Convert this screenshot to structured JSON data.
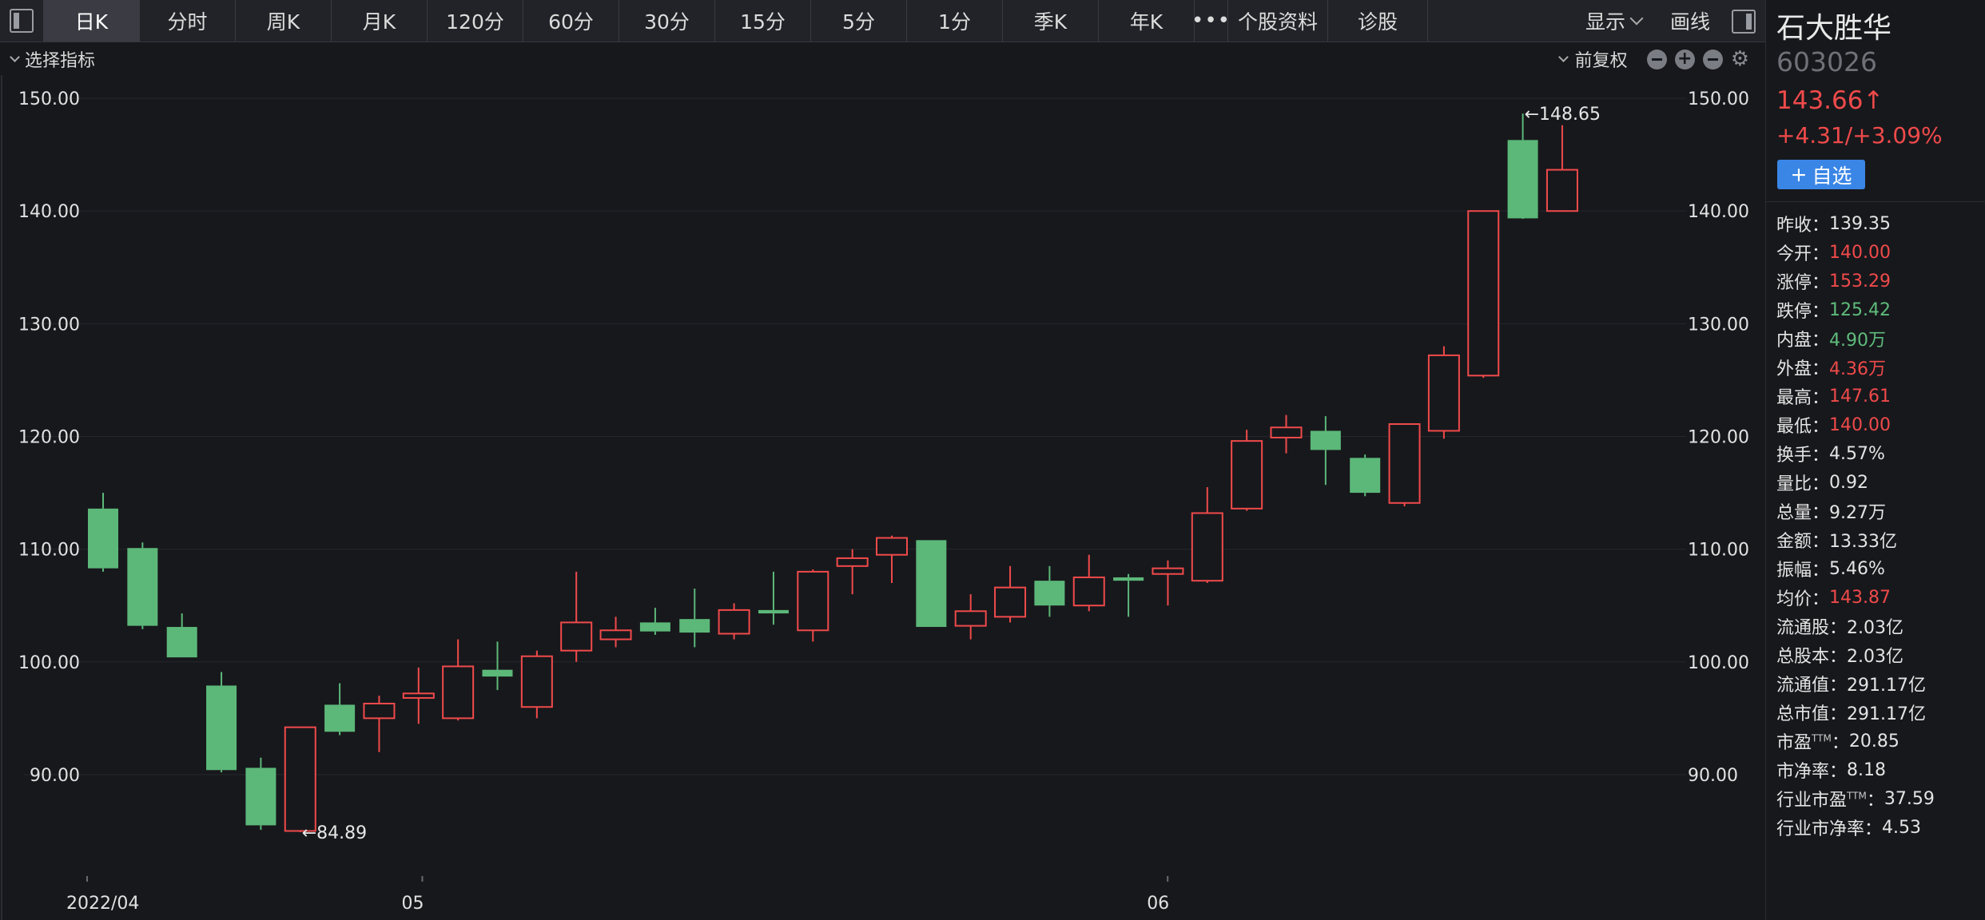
{
  "toolbar": {
    "tabs": [
      "日K",
      "分时",
      "周K",
      "月K",
      "120分",
      "60分",
      "30分",
      "15分",
      "5分",
      "1分",
      "季K",
      "年K"
    ],
    "active_tab": "日K",
    "more": "•••",
    "extra_tabs": [
      "个股资料",
      "诊股"
    ],
    "display": "显示",
    "draw": "画线"
  },
  "indicator_bar": {
    "select_indicator": "选择指标",
    "adjust": "前复权"
  },
  "chart_data": {
    "type": "candlestick",
    "y_ticks": [
      "150.00",
      "140.00",
      "130.00",
      "120.00",
      "110.00",
      "100.00",
      "90.00"
    ],
    "ylim": [
      80.5,
      151
    ],
    "x_labels": [
      {
        "label": "2022/04",
        "index": 0
      },
      {
        "label": "05",
        "index": 8.5
      },
      {
        "label": "06",
        "index": 27.4
      }
    ],
    "annotations": [
      {
        "text": "←148.65",
        "index": 36,
        "value": 148.65
      },
      {
        "text": "←84.89",
        "index": 5,
        "value": 84.89
      }
    ],
    "up_color": "#f04a4a",
    "down_color": "#5cb879",
    "candles": [
      {
        "o": 113.6,
        "h": 115.0,
        "l": 108.0,
        "c": 108.3
      },
      {
        "o": 110.1,
        "h": 110.6,
        "l": 102.9,
        "c": 103.2
      },
      {
        "o": 103.1,
        "h": 104.3,
        "l": 100.4,
        "c": 100.4
      },
      {
        "o": 97.9,
        "h": 99.1,
        "l": 90.2,
        "c": 90.4
      },
      {
        "o": 90.6,
        "h": 91.5,
        "l": 85.1,
        "c": 85.5
      },
      {
        "o": 85.0,
        "h": 94.2,
        "l": 84.89,
        "c": 94.2
      },
      {
        "o": 96.2,
        "h": 98.1,
        "l": 93.5,
        "c": 93.8
      },
      {
        "o": 95.0,
        "h": 97.0,
        "l": 92.0,
        "c": 96.3
      },
      {
        "o": 96.8,
        "h": 99.5,
        "l": 94.5,
        "c": 97.2
      },
      {
        "o": 95.0,
        "h": 102.0,
        "l": 94.8,
        "c": 99.6
      },
      {
        "o": 99.3,
        "h": 101.8,
        "l": 97.5,
        "c": 98.7
      },
      {
        "o": 96.0,
        "h": 101.0,
        "l": 95.0,
        "c": 100.5
      },
      {
        "o": 101.0,
        "h": 108.0,
        "l": 100.0,
        "c": 103.5
      },
      {
        "o": 102.0,
        "h": 104.0,
        "l": 101.3,
        "c": 102.8
      },
      {
        "o": 103.5,
        "h": 104.8,
        "l": 102.4,
        "c": 102.7
      },
      {
        "o": 103.8,
        "h": 106.5,
        "l": 101.3,
        "c": 102.6
      },
      {
        "o": 102.5,
        "h": 105.2,
        "l": 102.0,
        "c": 104.6
      },
      {
        "o": 104.6,
        "h": 108.0,
        "l": 103.3,
        "c": 104.3
      },
      {
        "o": 102.8,
        "h": 108.2,
        "l": 101.8,
        "c": 108.0
      },
      {
        "o": 108.5,
        "h": 110.0,
        "l": 106.0,
        "c": 109.2
      },
      {
        "o": 109.5,
        "h": 111.2,
        "l": 107.0,
        "c": 111.0
      },
      {
        "o": 110.8,
        "h": 110.8,
        "l": 103.1,
        "c": 103.1
      },
      {
        "o": 103.2,
        "h": 106.0,
        "l": 102.0,
        "c": 104.5
      },
      {
        "o": 104.0,
        "h": 108.5,
        "l": 103.5,
        "c": 106.6
      },
      {
        "o": 107.2,
        "h": 108.5,
        "l": 104.0,
        "c": 105.0
      },
      {
        "o": 105.0,
        "h": 109.5,
        "l": 104.5,
        "c": 107.5
      },
      {
        "o": 107.5,
        "h": 107.8,
        "l": 104.0,
        "c": 107.2
      },
      {
        "o": 107.8,
        "h": 109.0,
        "l": 105.0,
        "c": 108.3
      },
      {
        "o": 107.2,
        "h": 115.5,
        "l": 107.0,
        "c": 113.2
      },
      {
        "o": 113.6,
        "h": 120.6,
        "l": 113.4,
        "c": 119.6
      },
      {
        "o": 119.9,
        "h": 121.9,
        "l": 118.5,
        "c": 120.8
      },
      {
        "o": 120.5,
        "h": 121.8,
        "l": 115.7,
        "c": 118.8
      },
      {
        "o": 118.1,
        "h": 118.4,
        "l": 114.7,
        "c": 115.0
      },
      {
        "o": 114.1,
        "h": 121.1,
        "l": 113.8,
        "c": 121.1
      },
      {
        "o": 120.5,
        "h": 128.0,
        "l": 119.8,
        "c": 127.2
      },
      {
        "o": 125.4,
        "h": 140.0,
        "l": 125.2,
        "c": 140.0
      },
      {
        "o": 146.3,
        "h": 148.65,
        "l": 139.3,
        "c": 139.35
      },
      {
        "o": 140.0,
        "h": 147.61,
        "l": 140.0,
        "c": 143.66
      }
    ]
  },
  "stock": {
    "name": "石大胜华",
    "code": "603026",
    "price": "143.66",
    "arrow": "↑",
    "change": "+4.31/+3.09%",
    "watch_label": "自选",
    "watch_plus": "+",
    "up_color": "#ef4a4a",
    "down_color": "#5ebc7b",
    "stats": [
      {
        "label": "昨收：",
        "value": "139.35",
        "tone": "neutral"
      },
      {
        "label": "今开：",
        "value": "140.00",
        "tone": "up"
      },
      {
        "label": "涨停：",
        "value": "153.29",
        "tone": "up"
      },
      {
        "label": "跌停：",
        "value": "125.42",
        "tone": "down"
      },
      {
        "label": "内盘：",
        "value": "4.90万",
        "tone": "down"
      },
      {
        "label": "外盘：",
        "value": "4.36万",
        "tone": "up"
      },
      {
        "label": "最高：",
        "value": "147.61",
        "tone": "up"
      },
      {
        "label": "最低：",
        "value": "140.00",
        "tone": "up"
      },
      {
        "label": "换手：",
        "value": "4.57%",
        "tone": "neutral"
      },
      {
        "label": "量比：",
        "value": "0.92",
        "tone": "neutral"
      },
      {
        "label": "总量：",
        "value": "9.27万",
        "tone": "neutral"
      },
      {
        "label": "金额：",
        "value": "13.33亿",
        "tone": "neutral"
      },
      {
        "label": "振幅：",
        "value": "5.46%",
        "tone": "neutral"
      },
      {
        "label": "均价：",
        "value": "143.87",
        "tone": "up"
      },
      {
        "label": "流通股：",
        "value": "2.03亿",
        "tone": "neutral"
      },
      {
        "label": "总股本：",
        "value": "2.03亿",
        "tone": "neutral"
      },
      {
        "label": "流通值：",
        "value": "291.17亿",
        "tone": "neutral"
      },
      {
        "label": "总市值：",
        "value": "291.17亿",
        "tone": "neutral"
      },
      {
        "label": "市盈",
        "sup": "TTM",
        "label_suffix": "：",
        "value": "20.85",
        "tone": "neutral"
      },
      {
        "label": "市净率：",
        "value": "8.18",
        "tone": "neutral"
      },
      {
        "label": "行业市盈",
        "sup": "TTM",
        "label_suffix": "：",
        "value": "37.59",
        "tone": "neutral"
      },
      {
        "label": "行业市净率：",
        "value": "4.53",
        "tone": "neutral"
      }
    ]
  }
}
